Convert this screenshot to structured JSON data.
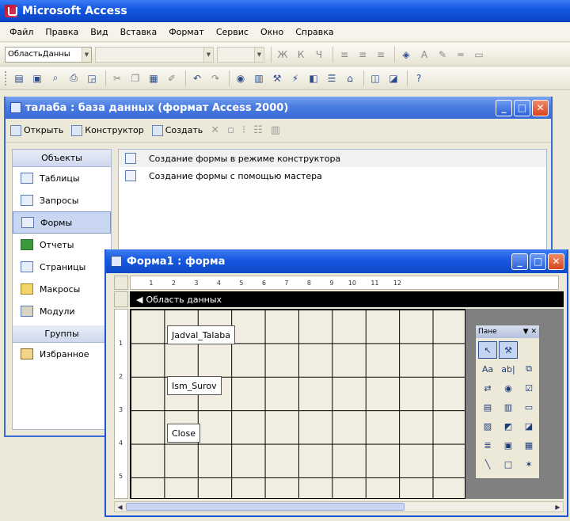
{
  "app": {
    "title": "Microsoft Access"
  },
  "menu": [
    "Файл",
    "Правка",
    "Вид",
    "Вставка",
    "Формат",
    "Сервис",
    "Окно",
    "Справка"
  ],
  "toolbar1": {
    "object_combo": "ОбластьДанны"
  },
  "db_window": {
    "title": "талаба : база данных (формат Access 2000)",
    "actions": {
      "open": "Открыть",
      "design": "Конструктор",
      "create": "Создать"
    },
    "objects_header": "Объекты",
    "objects": [
      {
        "label": "Таблицы",
        "icon": "table-icon"
      },
      {
        "label": "Запросы",
        "icon": "query-icon"
      },
      {
        "label": "Формы",
        "icon": "form-icon",
        "selected": true
      },
      {
        "label": "Отчеты",
        "icon": "report-icon"
      },
      {
        "label": "Страницы",
        "icon": "page-icon"
      },
      {
        "label": "Макросы",
        "icon": "macro-icon"
      },
      {
        "label": "Модули",
        "icon": "module-icon"
      }
    ],
    "groups_header": "Группы",
    "groups": [
      {
        "label": "Избранное",
        "icon": "favorites-icon"
      }
    ],
    "list": [
      "Создание формы в режиме конструктора",
      "Создание формы с помощью мастера"
    ]
  },
  "form_window": {
    "title": "Форма1 : форма",
    "section": "Область данных",
    "ruler_h": [
      "1",
      "2",
      "3",
      "4",
      "5",
      "6",
      "7",
      "8",
      "9",
      "10",
      "11",
      "12"
    ],
    "ruler_v": [
      "1",
      "2",
      "3",
      "4",
      "5"
    ],
    "controls": [
      {
        "label": "Jadval_Talaba"
      },
      {
        "label": "Ism_Surov"
      },
      {
        "label": "Close"
      }
    ],
    "toolbox": {
      "title": "Пане"
    }
  }
}
